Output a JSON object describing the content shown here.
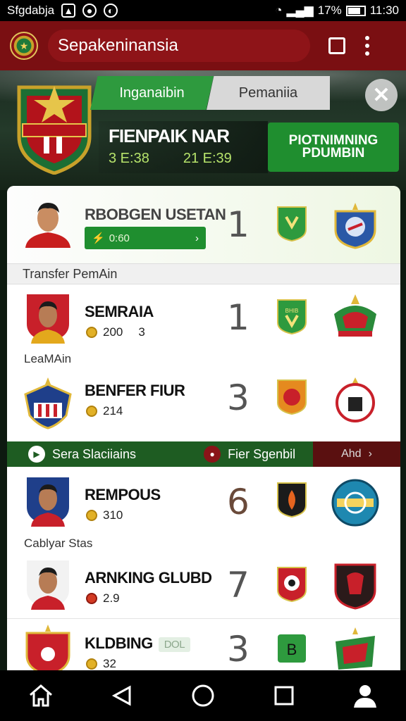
{
  "status_bar": {
    "carrier": "Sfgdabja",
    "battery": "17%",
    "time": "11:30"
  },
  "app_bar": {
    "title": "Sepakeninansia"
  },
  "hero": {
    "tabs": [
      {
        "label": "Inganaibin",
        "active": true
      },
      {
        "label": "Pemaniia",
        "active": false
      }
    ],
    "match_title": "FIENPAIK NAR",
    "times": [
      "3 E:38",
      "21 E:39"
    ],
    "cta": "PIOTNIMNING PDUMBIN"
  },
  "rows": [
    {
      "name": "RBOBGEN USETAN",
      "chip_value": "0:60",
      "rank": "1"
    },
    {
      "name": "SEMRAIA",
      "meta_a": "200",
      "meta_b": "3",
      "rank": "1"
    },
    {
      "name": "BENFER FIUR",
      "meta_a": "214",
      "rank": "3"
    },
    {
      "name": "REMPOUS",
      "meta_a": "310",
      "rank": "6"
    },
    {
      "name": "ARNKING GLUBD",
      "meta_a": "2.9",
      "rank": "7"
    },
    {
      "name": "KLDBING",
      "tag": "DOL",
      "meta_a": "32",
      "rank": "3"
    }
  ],
  "labels": {
    "section_transfer": "Transfer PemAin",
    "sub_a": "LeaMAin",
    "sub_b": "Cablyar Stas"
  },
  "filter_bar": {
    "item1": "Sera Slaciiains",
    "item2": "Fier Sgenbil",
    "item3": "Ahd"
  },
  "colors": {
    "primary_red": "#7a0f12",
    "accent_green": "#1f8e2f"
  }
}
